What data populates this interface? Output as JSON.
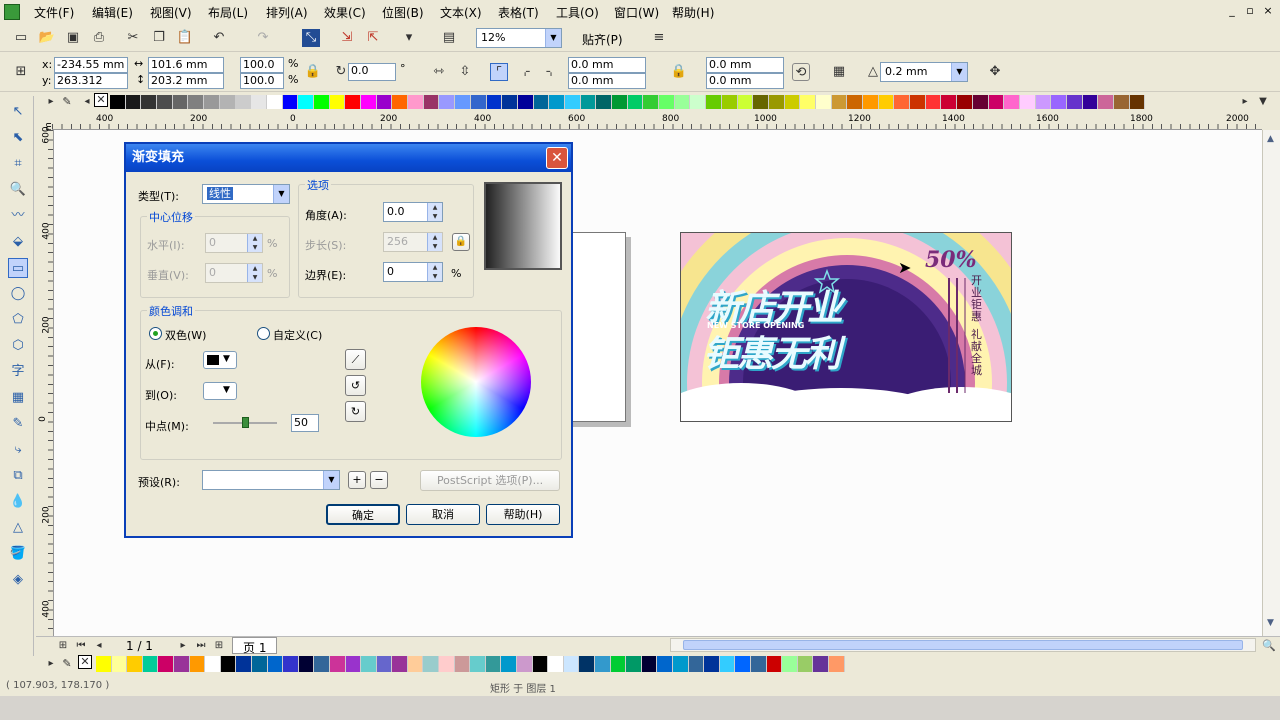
{
  "menu": {
    "items": [
      "文件(F)",
      "编辑(E)",
      "视图(V)",
      "布局(L)",
      "排列(A)",
      "效果(C)",
      "位图(B)",
      "文本(X)",
      "表格(T)",
      "工具(O)",
      "窗口(W)",
      "帮助(H)"
    ]
  },
  "window_controls": {
    "minimize": "_",
    "restore": "▫",
    "close": "×"
  },
  "standard_toolbar": {
    "zoom": "12%",
    "snap_label": "贴齐(P)"
  },
  "property_bar": {
    "x": "-234.55 mm",
    "y": "263.312 mm",
    "width": "101.6 mm",
    "height": "203.2 mm",
    "scale_x": "100.0",
    "scale_y": "100.0",
    "percent": "%",
    "rotation": "0.0",
    "degree": "°",
    "corner_1": "0.0 mm",
    "corner_2": "0.0 mm",
    "corner_3": "0.0 mm",
    "corner_4": "0.0 mm",
    "outline": "0.2 mm"
  },
  "ruler": {
    "h_labels": [
      "400",
      "200",
      "0",
      "200",
      "400",
      "600",
      "800",
      "1000",
      "1200",
      "1400",
      "1600",
      "1800",
      "2000"
    ],
    "v_labels": [
      "600",
      "400",
      "200",
      "0",
      "200",
      "400"
    ],
    "unit": "mm"
  },
  "dialog": {
    "title": "渐变填充",
    "type_label": "类型(T):",
    "type_value": "线性",
    "center_offset_title": "中心位移",
    "horizontal_label": "水平(I):",
    "horizontal_value": "0",
    "vertical_label": "垂直(V):",
    "vertical_value": "0",
    "options_title": "选项",
    "angle_label": "角度(A):",
    "angle_value": "0.0",
    "steps_label": "步长(S):",
    "steps_value": "256",
    "edge_label": "边界(E):",
    "edge_value": "0",
    "pct": "%",
    "blend_title": "颜色调和",
    "two_color_label": "双色(W)",
    "custom_label": "自定义(C)",
    "from_label": "从(F):",
    "to_label": "到(O):",
    "midpoint_label": "中点(M):",
    "midpoint_value": "50",
    "midpoint_level": 0.5,
    "presets_label": "预设(R):",
    "postscript_label": "PostScript 选项(P)...",
    "ok_label": "确定",
    "cancel_label": "取消",
    "help_label": "帮助(H)"
  },
  "artwork": {
    "headline_1": "新店开业",
    "headline_2": "钜惠无利",
    "subline": "NEW STORE OPENING",
    "discount": "50%",
    "side_text": "开业钜惠",
    "side_text_2": "礼献全城"
  },
  "pager": {
    "page_count": "1 / 1",
    "page_tab": "页 1"
  },
  "status": {
    "coords": "( 107.903, 178.170 )",
    "object_info": "矩形 于 图层 1"
  },
  "colors": {
    "titlebar": "#0b4fd8",
    "accent": "#0046d5"
  }
}
